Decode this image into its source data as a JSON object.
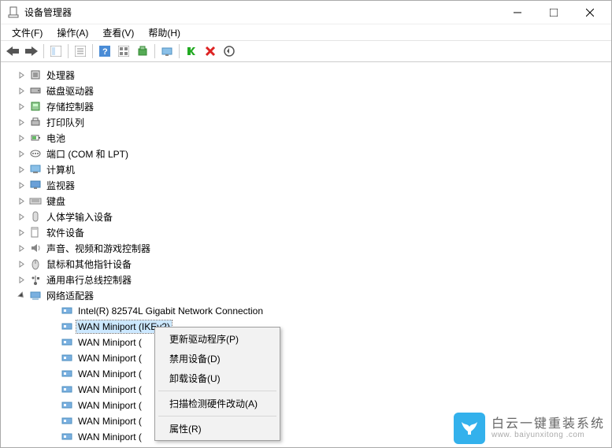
{
  "window": {
    "title": "设备管理器"
  },
  "menubar": [
    "文件(F)",
    "操作(A)",
    "查看(V)",
    "帮助(H)"
  ],
  "categories": [
    {
      "label": "处理器",
      "type": "cpu"
    },
    {
      "label": "磁盘驱动器",
      "type": "disk"
    },
    {
      "label": "存储控制器",
      "type": "storage"
    },
    {
      "label": "打印队列",
      "type": "printer"
    },
    {
      "label": "电池",
      "type": "battery"
    },
    {
      "label": "端口 (COM 和 LPT)",
      "type": "port"
    },
    {
      "label": "计算机",
      "type": "computer"
    },
    {
      "label": "监视器",
      "type": "monitor"
    },
    {
      "label": "键盘",
      "type": "keyboard"
    },
    {
      "label": "人体学输入设备",
      "type": "hid"
    },
    {
      "label": "软件设备",
      "type": "software"
    },
    {
      "label": "声音、视频和游戏控制器",
      "type": "sound"
    },
    {
      "label": "鼠标和其他指针设备",
      "type": "mouse"
    },
    {
      "label": "通用串行总线控制器",
      "type": "usb"
    }
  ],
  "network_category": {
    "label": "网络适配器"
  },
  "network_children": [
    {
      "label": "Intel(R) 82574L Gigabit Network Connection"
    },
    {
      "label": "WAN Miniport (IKEv2)",
      "selected": true
    },
    {
      "label": "WAN Miniport ("
    },
    {
      "label": "WAN Miniport ("
    },
    {
      "label": "WAN Miniport ("
    },
    {
      "label": "WAN Miniport ("
    },
    {
      "label": "WAN Miniport ("
    },
    {
      "label": "WAN Miniport ("
    },
    {
      "label": "WAN Miniport ("
    }
  ],
  "context_menu": {
    "items_block1": [
      "更新驱动程序(P)",
      "禁用设备(D)",
      "卸载设备(U)"
    ],
    "items_block2": [
      "扫描检测硬件改动(A)"
    ],
    "items_block3": [
      "属性(R)"
    ]
  },
  "watermark": {
    "main": "白云一键重装系统",
    "sub": "www. baiyunxitong .com"
  }
}
